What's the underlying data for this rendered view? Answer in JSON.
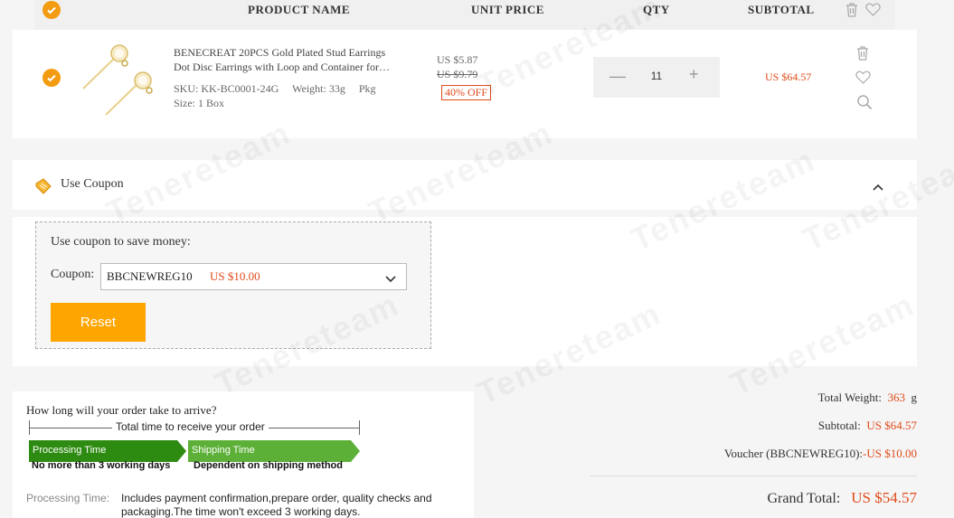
{
  "header": {
    "product_name": "PRODUCT NAME",
    "unit_price": "UNIT PRICE",
    "qty": "QTY",
    "subtotal": "SUBTOTAL"
  },
  "item": {
    "title_line1": "BENECREAT 20PCS Gold Plated Stud Earrings",
    "title_line2": "Dot Disc Earrings with Loop and Container for…",
    "sku": "SKU: KK-BC0001-24G",
    "weight": "Weight: 33g",
    "pkg": "Pkg",
    "size": "Size: 1 Box",
    "price_now": "US $5.87",
    "price_was": "US $9.79",
    "discount": "40% OFF",
    "quantity": "11",
    "subtotal": "US $64.57",
    "minus": "—",
    "plus": "+"
  },
  "coupon": {
    "bar_label": "Use Coupon",
    "hint": "Use coupon to save money:",
    "label": "Coupon:",
    "selected_code": "BBCNEWREG10",
    "selected_amount": "US $10.00",
    "reset_label": "Reset"
  },
  "delivery": {
    "question": "How long will your order take to arrive?",
    "total_time": "Total time to receive your order",
    "processing_title": "Processing Time",
    "processing_sub": "No more than 3 working days",
    "shipping_title": "Shipping Time",
    "shipping_sub": "Dependent on shipping method",
    "processing_label": "Processing Time:",
    "processing_text": "Includes payment confirmation,prepare order, quality checks and packaging.The time won't exceed 3 working days."
  },
  "summary": {
    "total_weight_label": "Total Weight:",
    "total_weight_value": "363",
    "total_weight_unit": "g",
    "subtotal_label": "Subtotal:",
    "subtotal_value": "US $64.57",
    "voucher_label": "Voucher (BBCNEWREG10):",
    "voucher_value": "-US $10.00",
    "grand_label": "Grand Total:",
    "grand_value": "US $54.57"
  },
  "watermark": "Tenereteam",
  "colors": {
    "accent_orange": "#f39c12",
    "price_red": "#e04b1a",
    "reset_button": "#ffa500",
    "processing_green": "#2e8b12",
    "shipping_green": "#5cb037"
  }
}
